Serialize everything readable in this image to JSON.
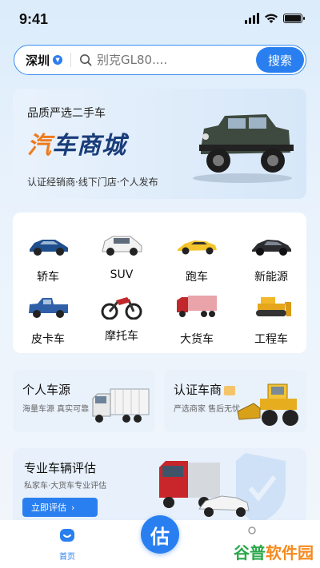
{
  "status": {
    "time": "9:41"
  },
  "search": {
    "city": "深圳",
    "placeholder": "别克GL80....",
    "button": "搜索"
  },
  "banner": {
    "subtitle": "品质严选二手车",
    "title_accent": "汽",
    "title_rest": "车商城",
    "tags": "认证经销商·线下门店·个人发布"
  },
  "categories": [
    {
      "label": "轿车",
      "icon": "sedan-icon"
    },
    {
      "label": "SUV",
      "icon": "suv-icon"
    },
    {
      "label": "跑车",
      "icon": "sportscar-icon"
    },
    {
      "label": "新能源",
      "icon": "ev-icon"
    },
    {
      "label": "皮卡车",
      "icon": "pickup-icon"
    },
    {
      "label": "摩托车",
      "icon": "motorcycle-icon"
    },
    {
      "label": "大货车",
      "icon": "truck-icon"
    },
    {
      "label": "工程车",
      "icon": "bulldozer-icon"
    }
  ],
  "cards": [
    {
      "title": "个人车源",
      "sub": "海量车源 真实可靠"
    },
    {
      "title": "认证车商",
      "sub": "严选商家 售后无忧"
    }
  ],
  "eval": {
    "title": "专业车辆评估",
    "sub": "私家车·大货车专业评估",
    "button": "立即评估"
  },
  "tabbar": {
    "home": "首页",
    "center": "估"
  },
  "watermark": {
    "part1": "谷普",
    "part2": "软件园"
  },
  "colors": {
    "accent": "#2a7ff0",
    "banner_title": "#1a3d7a",
    "banner_accent": "#f07a1a"
  }
}
